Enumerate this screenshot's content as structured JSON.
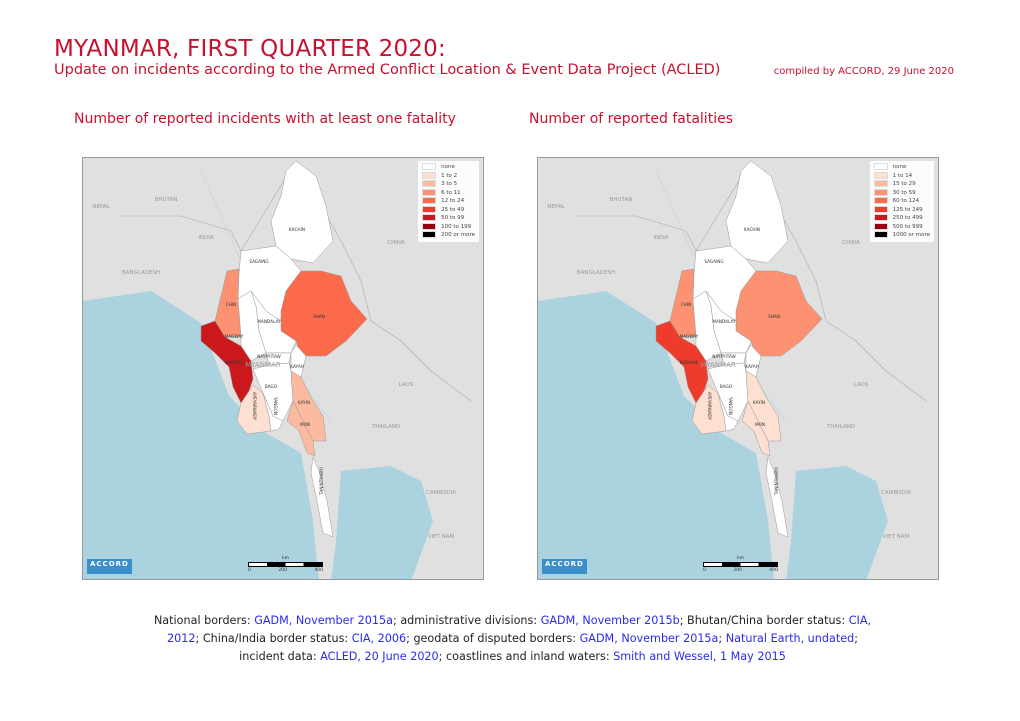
{
  "header": {
    "title": "MYANMAR, FIRST QUARTER 2020:",
    "subtitle": "Update on incidents according to the Armed Conflict Location & Event Data Project (ACLED)",
    "compiled": "compiled by ACCORD, 29 June 2020"
  },
  "colors": {
    "accent": "#c8102e",
    "sea": "#aad3df",
    "land": "#e0e0e0",
    "myanmar_base": "#ffffff",
    "link": "#2a2af0"
  },
  "maps": [
    {
      "title": "Number of reported incidents with at least one fatality",
      "legend": [
        {
          "label": "none",
          "color": "#ffffff"
        },
        {
          "label": "1 to 2",
          "color": "#fee0d2"
        },
        {
          "label": "3 to 5",
          "color": "#fcbba1"
        },
        {
          "label": "6 to 11",
          "color": "#fc9272"
        },
        {
          "label": "12 to 24",
          "color": "#fb6a4a"
        },
        {
          "label": "25 to 49",
          "color": "#ef3b2c"
        },
        {
          "label": "50 to 99",
          "color": "#cb181d"
        },
        {
          "label": "100 to 199",
          "color": "#99000d"
        },
        {
          "label": "200 or more",
          "color": "#000000"
        }
      ],
      "regions": {
        "KACHIN": "none",
        "SAGAING": "none",
        "CHIN": "6 to 11",
        "SHAN": "12 to 24",
        "MANDALAY": "none",
        "MAGWAY": "none",
        "RAKHINE": "50 to 99",
        "NAYPYITAW": "none",
        "KAYAH": "none",
        "BAGO": "none",
        "AYEYARWADY": "1 to 2",
        "YANGON": "none",
        "KAYIN": "3 to 5",
        "MON": "3 to 5",
        "TANINTHARYI": "none"
      }
    },
    {
      "title": "Number of reported fatalities",
      "legend": [
        {
          "label": "none",
          "color": "#ffffff"
        },
        {
          "label": "1 to 14",
          "color": "#fee0d2"
        },
        {
          "label": "15 to 29",
          "color": "#fcbba1"
        },
        {
          "label": "30 to 59",
          "color": "#fc9272"
        },
        {
          "label": "60 to 124",
          "color": "#fb6a4a"
        },
        {
          "label": "125 to 249",
          "color": "#ef3b2c"
        },
        {
          "label": "250 to 499",
          "color": "#cb181d"
        },
        {
          "label": "500 to 999",
          "color": "#99000d"
        },
        {
          "label": "1000 or more",
          "color": "#000000"
        }
      ],
      "regions": {
        "KACHIN": "none",
        "SAGAING": "none",
        "CHIN": "30 to 59",
        "SHAN": "30 to 59",
        "MANDALAY": "none",
        "MAGWAY": "none",
        "RAKHINE": "125 to 249",
        "NAYPYITAW": "none",
        "KAYAH": "none",
        "BAGO": "none",
        "AYEYARWADY": "1 to 14",
        "YANGON": "none",
        "KAYIN": "1 to 14",
        "MON": "1 to 14",
        "TANINTHARYI": "none"
      }
    }
  ],
  "country_labels": [
    "NEPAL",
    "BHUTAN",
    "INDIA",
    "CHINA",
    "BANGLADESH",
    "MYANMAR",
    "LAOS",
    "THAILAND",
    "CAMBODIA",
    "VIET NAM"
  ],
  "scale": {
    "unit": "km",
    "ticks": [
      "0",
      "200",
      "400"
    ]
  },
  "logo": {
    "text": "ACCORD"
  },
  "footer": [
    {
      "t": "National borders: "
    },
    {
      "t": "GADM, November 2015a",
      "link": true
    },
    {
      "t": "; administrative divisions: "
    },
    {
      "t": "GADM, November 2015b",
      "link": true
    },
    {
      "t": "; Bhutan/China border status: "
    },
    {
      "t": "CIA, 2012",
      "link": true
    },
    {
      "t": "; China/India border status: "
    },
    {
      "t": "CIA, 2006",
      "link": true
    },
    {
      "t": "; geodata of disputed borders: "
    },
    {
      "t": "GADM, November 2015a",
      "link": true
    },
    {
      "t": "; "
    },
    {
      "t": "Natural Earth, undated",
      "link": true
    },
    {
      "t": "; incident data: "
    },
    {
      "t": "ACLED, 20 June 2020",
      "link": true
    },
    {
      "t": "; coastlines and inland waters: "
    },
    {
      "t": "Smith and Wessel, 1 May 2015",
      "link": true
    }
  ]
}
